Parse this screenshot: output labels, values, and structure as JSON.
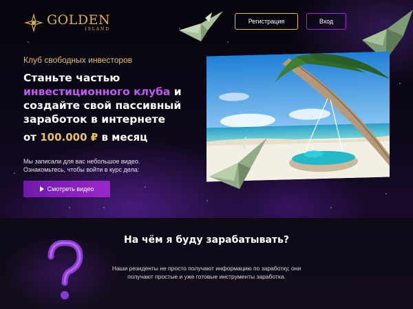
{
  "brand": {
    "logo_text": "GOLDEN",
    "logo_subtext": "ISLAND"
  },
  "header": {
    "register_label": "Регистрация",
    "login_label": "Вход"
  },
  "hero": {
    "kicker": "Клуб свободных инвесторов",
    "headline_part1": "Станьте частью",
    "headline_accent": "инвестиционного клуба",
    "headline_part2": "и создайте свой пассивный заработок в интернете",
    "income_prefix": "от",
    "income_amount": "100.000 ₽",
    "income_suffix": "в месяц",
    "description": "Мы записали для вас небольшое видео. Ознакомьтесь, чтобы войти в курс дела:",
    "video_button_label": "Смотреть видео"
  },
  "earn_section": {
    "title": "На чём я буду зарабатывать?",
    "text": "Наши резиденты не просто получают информацию по заработку, они получают простые и уже готовые инструменты заработка."
  },
  "colors": {
    "gold": "#e4c46a",
    "purple_accent": "#c15af0",
    "button_purple": "#9b28c9",
    "background": "#0a0612"
  },
  "icons": {
    "logo": "star-compass-icon",
    "play": "play-icon",
    "question": "question-mark-icon",
    "origami": "money-origami-bird-icon"
  }
}
